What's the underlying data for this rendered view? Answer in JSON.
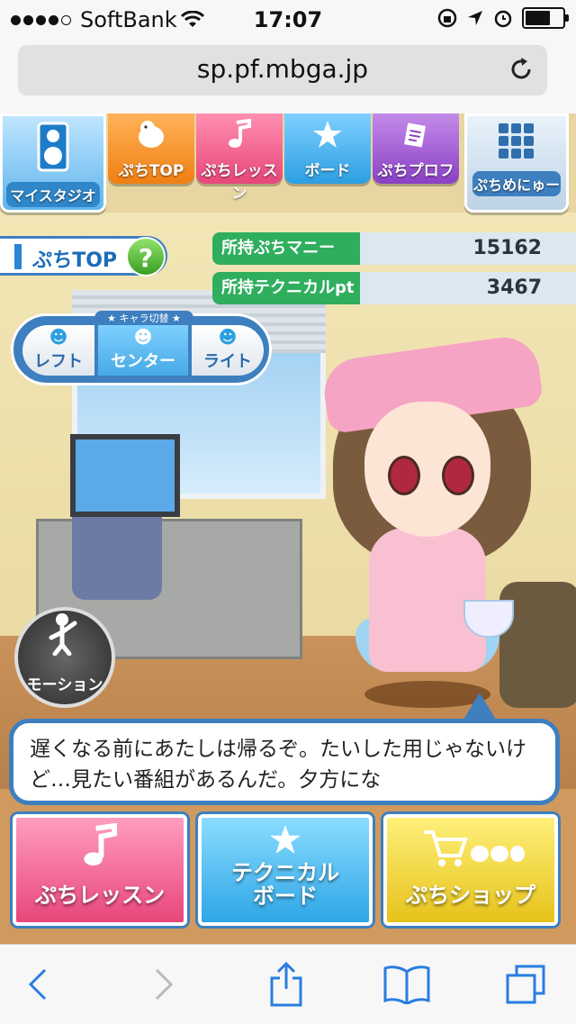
{
  "status_bar": {
    "carrier": "SoftBank",
    "time": "17:07",
    "signal_bars": 4,
    "battery_level": 0.75
  },
  "browser": {
    "url": "sp.pf.mbga.jp"
  },
  "nav_tabs": [
    {
      "label": "マイスタジオ",
      "icon": "speaker-icon"
    },
    {
      "label": "ぷちTOP",
      "icon": "chick-icon"
    },
    {
      "label": "ぷちレッスン",
      "icon": "music-note-icon"
    },
    {
      "label": "ボード",
      "icon": "star-icon"
    },
    {
      "label": "ぷちプロフ",
      "icon": "notepad-icon"
    },
    {
      "label": "ぷちめにゅー",
      "icon": "grid-icon"
    }
  ],
  "page_title": "ぷちTOP",
  "help_label": "?",
  "stats": [
    {
      "label": "所持ぷちマニー",
      "value": "15162"
    },
    {
      "label": "所持テクニカルpt",
      "value": "3467"
    }
  ],
  "character_switch": {
    "title": "★ キャラ切替 ★",
    "buttons": [
      "レフト",
      "センター",
      "ライト"
    ],
    "selected": "センター"
  },
  "motion_button": {
    "label": "モーション"
  },
  "speech": {
    "text": "遅くなる前にあたしは帰るぞ。たいした用じゃないけど…見たい番組があるんだ。夕方にな"
  },
  "main_buttons": [
    {
      "label": "ぷちレッスン",
      "icon": "music-note-icon"
    },
    {
      "label_line1": "テクニカル",
      "label_line2": "ボード",
      "icon": "star-icon"
    },
    {
      "label": "ぷちショップ",
      "icon": "shopping-cart-icon"
    }
  ],
  "colors": {
    "accent_blue": "#3d7fbf",
    "stat_green": "#2fae5e"
  }
}
